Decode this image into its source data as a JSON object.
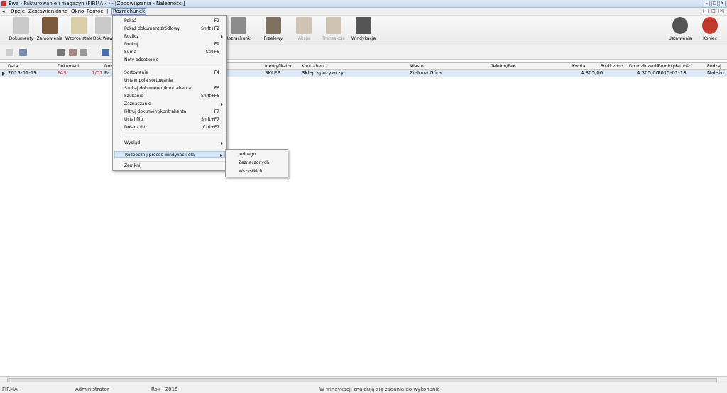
{
  "window": {
    "title": "Ewa - Fakturowanie i magazyn (FIRMA - ) - [Zobowiązania - Należności]"
  },
  "menubar": {
    "items": [
      "Opcje",
      "Zestawienia",
      "Inne",
      "Okno",
      "Pomoc",
      "|",
      "Rozrachunek"
    ]
  },
  "toolbar": {
    "buttons": [
      {
        "label": "Dokumenty",
        "icon": "documents-icon",
        "color": "#c9c9c9"
      },
      {
        "label": "Zamówienia",
        "icon": "orders-icon",
        "color": "#7a5a3a"
      },
      {
        "label": "Wzorce stałe",
        "icon": "templates-icon",
        "color": "#d9cfa8"
      },
      {
        "label": "Dok Wew",
        "icon": "internal-docs-icon",
        "color": "#c9c9c9"
      },
      {
        "label": "Rozrachunki",
        "icon": "settlements-icon",
        "color": "#8c8c8c"
      },
      {
        "label": "Przelewy",
        "icon": "transfers-icon",
        "color": "#7d7060"
      },
      {
        "label": "Akcje",
        "icon": "actions-icon",
        "color": "#cfc3b3"
      },
      {
        "label": "Transakcje",
        "icon": "transactions-icon",
        "color": "#cfc3b3"
      },
      {
        "label": "Windykacja",
        "icon": "debt-collection-icon",
        "color": "#555555"
      },
      {
        "label": "Ustawienia",
        "icon": "settings-gear-icon",
        "color": "#555555"
      },
      {
        "label": "Koniec",
        "icon": "power-icon",
        "color": "#c0392b"
      }
    ]
  },
  "grid": {
    "headers": [
      "Data",
      "Dokument",
      "Dok",
      "Identyfikator",
      "Kontrahent",
      "Miasto",
      "Telefon/Fax",
      "Kwota",
      "Rozliczono",
      "Do rozliczenia",
      "Termin płatności",
      "Rodzaj"
    ],
    "rows": [
      {
        "date": "2015-01-19",
        "doc": "FAS",
        "docnum": "1/01",
        "dok": "Fa",
        "id": "SKLEP",
        "contractor": "Sklep spożywczy",
        "city": "Zielona Góra",
        "phone": "",
        "amount": "4 305,00",
        "settled": "",
        "to_settle": "4 305,00",
        "due": "2015-01-18",
        "kind": "Należn"
      }
    ]
  },
  "context_menu": {
    "items": [
      {
        "label": "Pokaż",
        "shortcut": "F2"
      },
      {
        "label": "Pokaż dokument źródłowy",
        "shortcut": "Shift+F2"
      },
      {
        "label": "Rozlicz",
        "shortcut": "",
        "submenu": true
      },
      {
        "label": "Drukuj",
        "shortcut": "F9"
      },
      {
        "label": "Suma",
        "shortcut": "Ctrl+S"
      },
      {
        "label": "Noty odsetkowe",
        "shortcut": ""
      },
      {
        "label": "Sortowanie",
        "shortcut": "F4"
      },
      {
        "label": "Ustaw pola sortowania",
        "shortcut": ""
      },
      {
        "label": "Szukaj dokumentu/kontrahenta",
        "shortcut": "F6"
      },
      {
        "label": "Szukanie",
        "shortcut": "Shift+F6"
      },
      {
        "label": "Zaznaczanie",
        "shortcut": "",
        "submenu": true
      },
      {
        "label": "Filtruj dokument/kontrahenta",
        "shortcut": "F7"
      },
      {
        "label": "Ustal filtr",
        "shortcut": "Shift+F7"
      },
      {
        "label": "Dołącz filtr",
        "shortcut": "Ctrl+F7"
      },
      {
        "label": "Wygląd",
        "shortcut": "",
        "submenu": true
      },
      {
        "label": "Rozpocznij proces windykacji dla",
        "shortcut": "",
        "submenu": true
      },
      {
        "label": "Zamknij",
        "shortcut": ""
      }
    ]
  },
  "submenu": {
    "items": [
      "Jednego",
      "Zaznaczonych",
      "Wszystkich"
    ]
  },
  "status": {
    "company": "FIRMA -",
    "user": "Administrator",
    "year": "Rok : 2015",
    "message": "W windykacji znajdują się zadania do wykonania"
  }
}
